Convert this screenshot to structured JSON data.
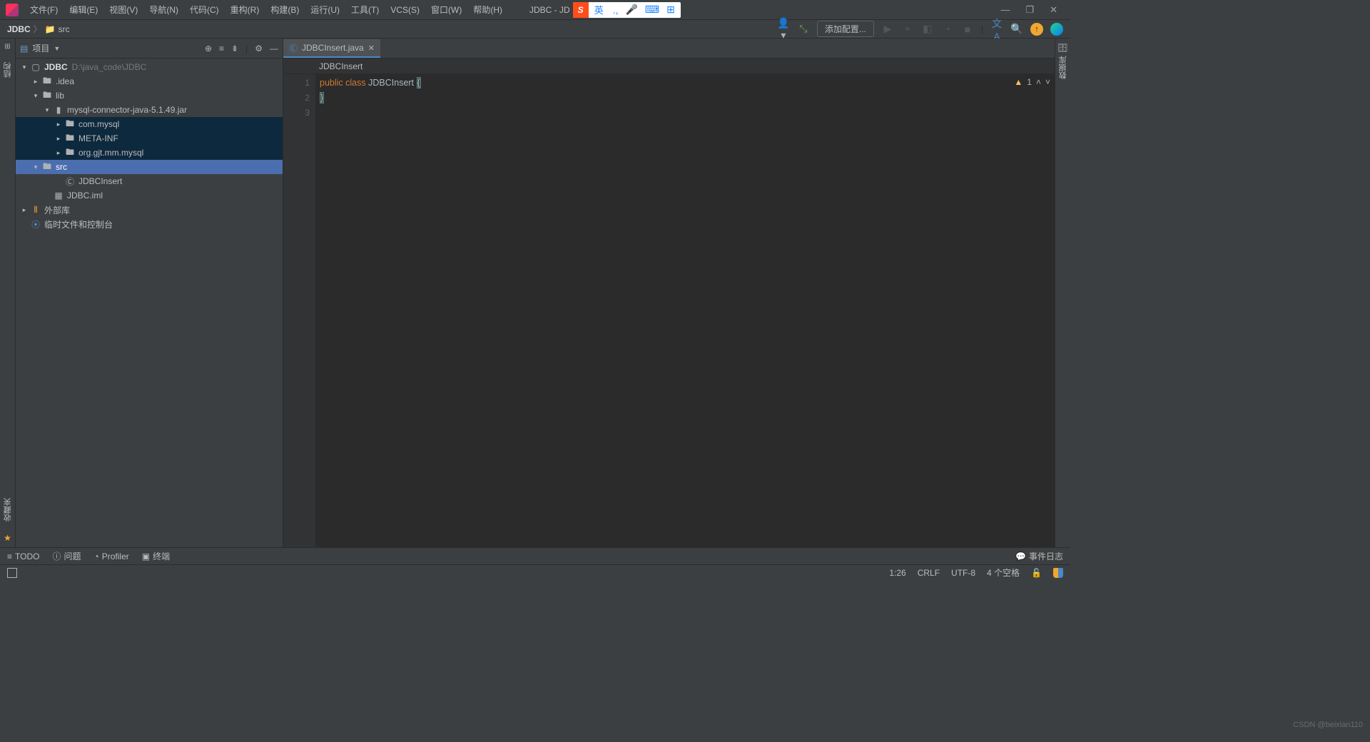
{
  "menu": {
    "items": [
      "文件(F)",
      "编辑(E)",
      "视图(V)",
      "导航(N)",
      "代码(C)",
      "重构(R)",
      "构建(B)",
      "运行(U)",
      "工具(T)",
      "VCS(S)",
      "窗口(W)",
      "帮助(H)"
    ],
    "title": "JDBC - JD",
    "ime_lang": "英",
    "ime_dot": ".,",
    "window_controls": [
      "—",
      "❐",
      "✕"
    ]
  },
  "nav": {
    "crumb1": "JDBC",
    "crumb2": "src",
    "add_config": "添加配置..."
  },
  "left_rail": {
    "structure": "结构",
    "favorites": "收藏夹"
  },
  "project_panel": {
    "title": "项目",
    "root": {
      "name": "JDBC",
      "path": "D:\\java_code\\JDBC"
    },
    "idea": ".idea",
    "lib": "lib",
    "jar": "mysql-connector-java-5.1.49.jar",
    "jar_children": [
      "com.mysql",
      "META-INF",
      "org.gjt.mm.mysql"
    ],
    "src": "src",
    "class": "JDBCInsert",
    "iml": "JDBC.iml",
    "ext_libs": "外部库",
    "scratch": "临时文件和控制台"
  },
  "editor": {
    "tab": "JDBCInsert.java",
    "breadcrumb": "JDBCInsert",
    "lines": {
      "l1": "1",
      "l2": "2",
      "l3": "3"
    },
    "code": {
      "kw_public": "public",
      "kw_class": "class",
      "classname": "JDBCInsert",
      "ob": "{",
      "cb": "}"
    },
    "warn_count": "1"
  },
  "right_rail": {
    "db": "数据库"
  },
  "bottom": {
    "todo": "TODO",
    "problems": "问题",
    "profiler": "Profiler",
    "terminal": "终端",
    "event_log": "事件日志"
  },
  "status": {
    "pos": "1:26",
    "line_sep": "CRLF",
    "enc": "UTF-8",
    "indent": "4 个空格"
  },
  "watermark": "CSDN @beixian110"
}
